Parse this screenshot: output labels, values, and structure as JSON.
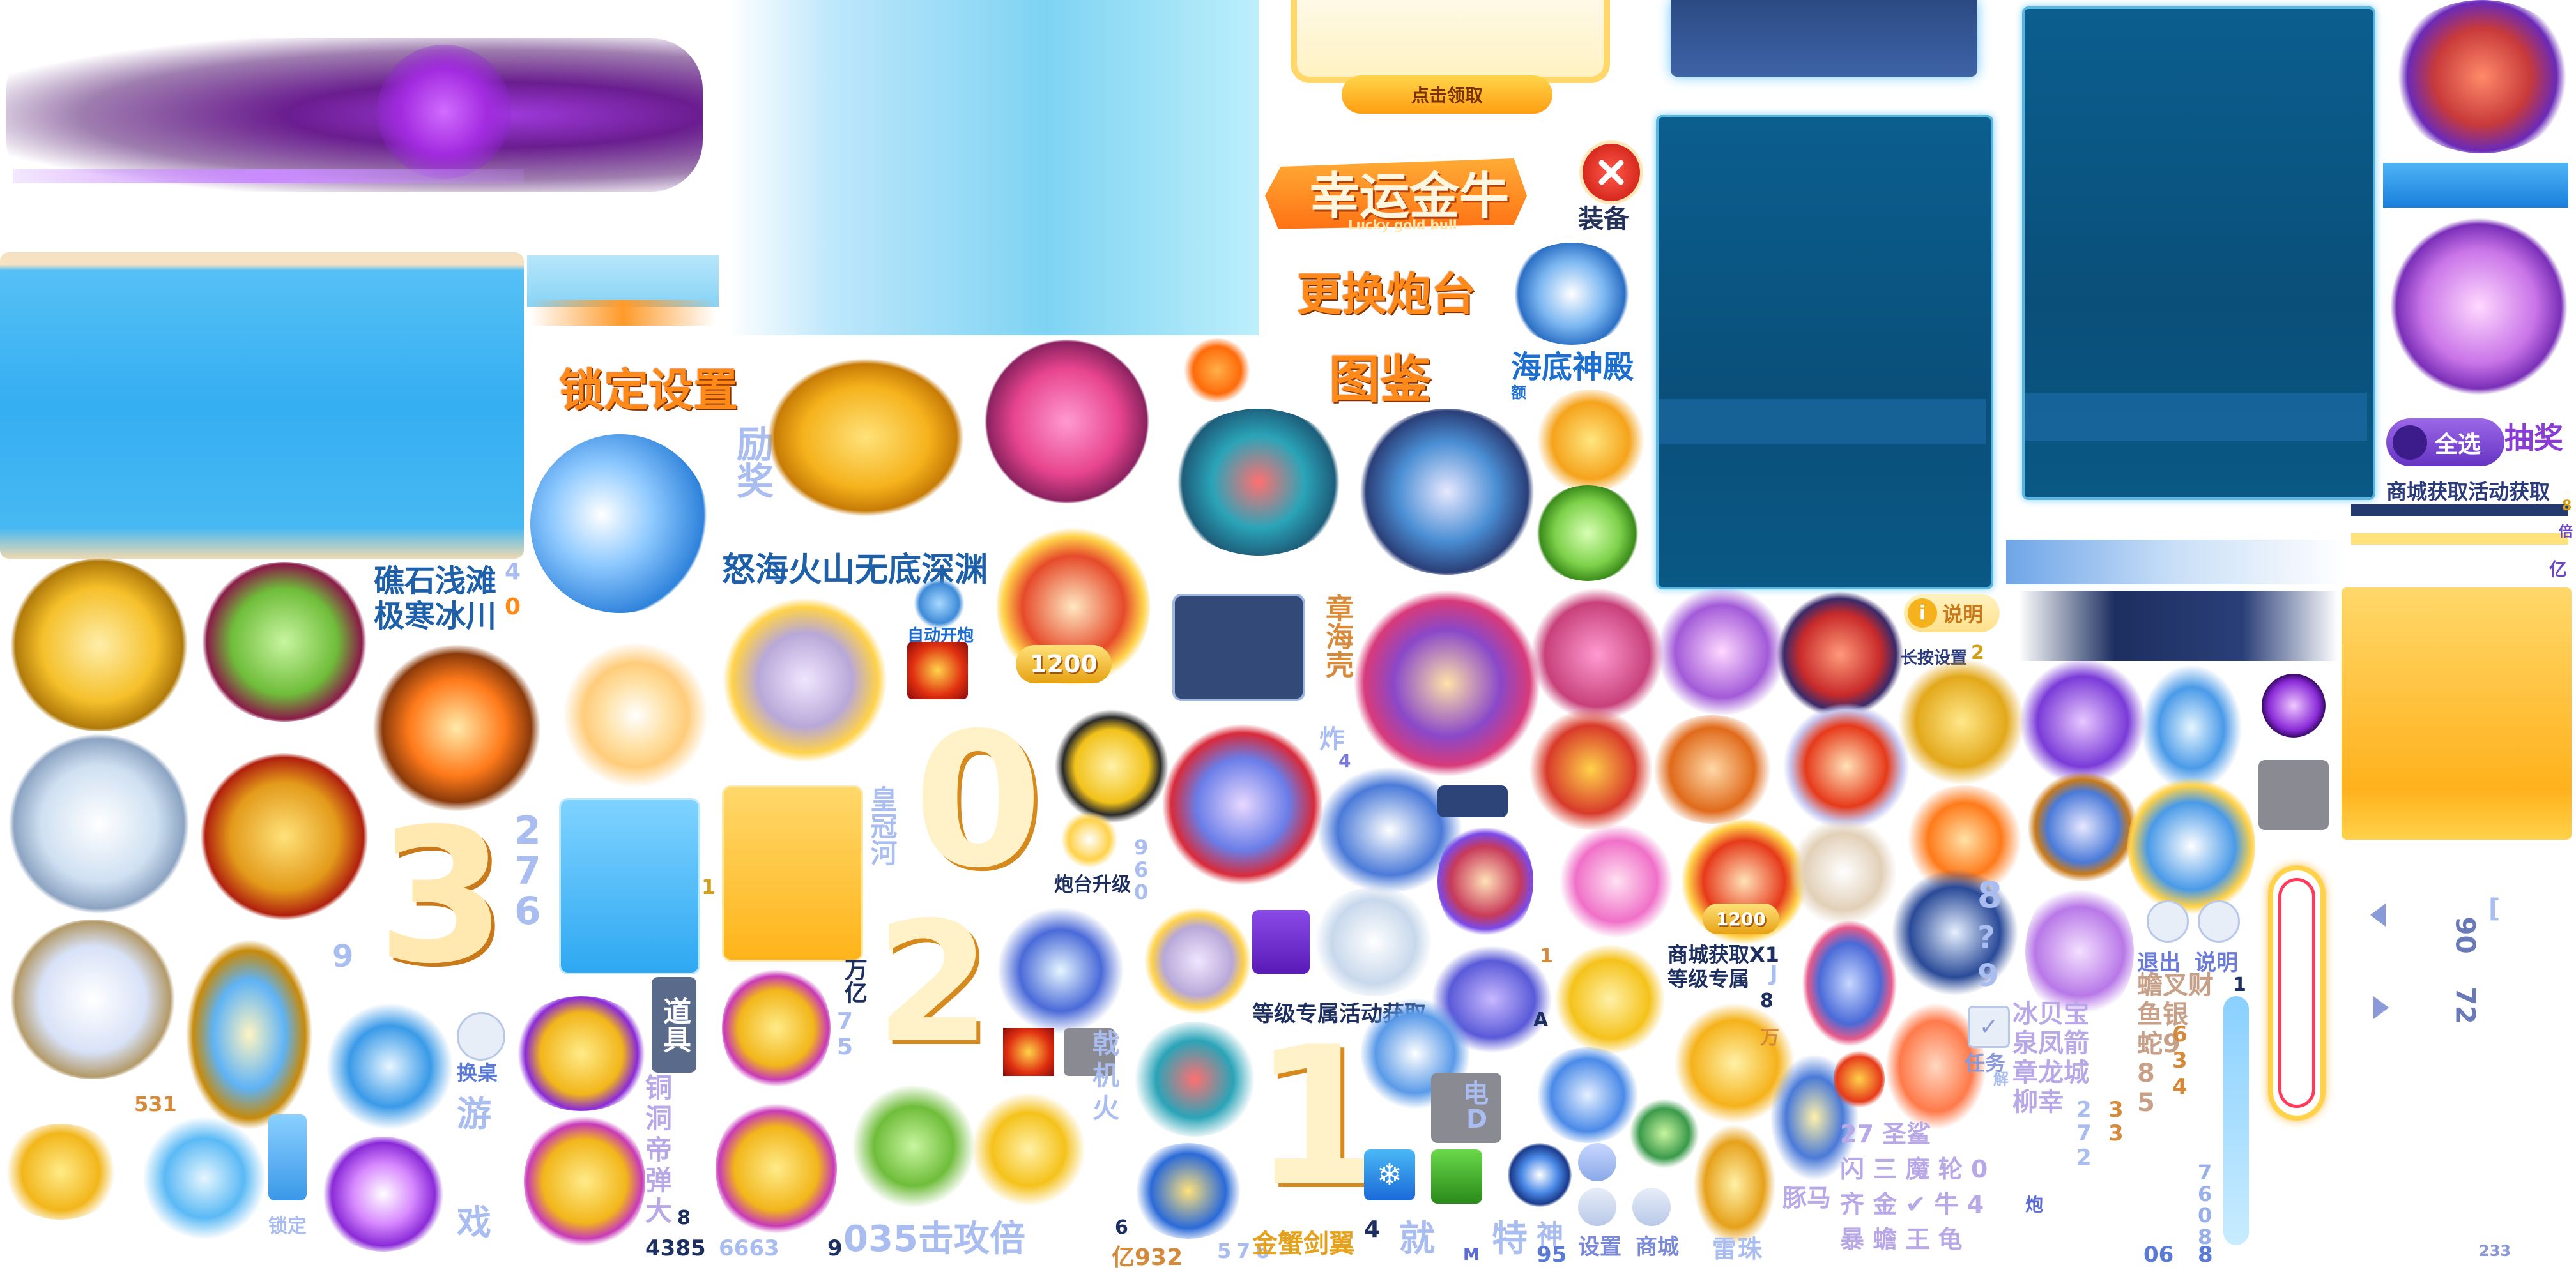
{
  "atlas": {
    "claim_button": "点击领取",
    "lucky_bull_title": "幸运金牛",
    "lucky_bull_subtitle": "Lucky gold bull",
    "equip_label": "装备",
    "change_turret": "更换炮台",
    "gallery": "图鉴",
    "lock_settings": "锁定设置",
    "poseidon_temple": "海底神殿",
    "temple_small": "额",
    "reward_vertical": "励奖",
    "map_reef": "礁石浅滩",
    "map_glacier": "极寒冰川",
    "map_digit_4": "4",
    "map_digit_0": "0",
    "map_names": "怒海火山无底深渊",
    "auto_fire": "自动开炮",
    "digit_1200": "1200",
    "digit_1200_b": "1200",
    "vertical_sea": "章海壳",
    "vertical_fire": "炸",
    "fire_small": "4",
    "info_label": "说明",
    "long_press": "长按设置",
    "long_press_num": "2",
    "select_all": "全选",
    "lottery": "抽奖",
    "shop_activity": "商城获取活动获取",
    "rate_8": "8",
    "rate_bei": "倍",
    "rate_yi": "亿",
    "big_3": "3",
    "big_0": "0",
    "big_2": "2",
    "big_1": "1",
    "nums_276": "2\n7\n6",
    "num_9": "9",
    "num_1": "1",
    "emperor_river": "皇冠河",
    "turret_upgrade": "炮台升级",
    "turret_nums": "9\n6\n0",
    "level_exclusive_activity": "等级专属活动获取",
    "shop_x1": "商城获取X1",
    "level_exclusive": "等级专属",
    "num_8": "8",
    "wan": "万",
    "j": "J",
    "a_label": "A",
    "n_label": "1",
    "qmark": "?",
    "num_8b": "8",
    "num_9b": "9",
    "change_table": "换桌",
    "you": "游",
    "xi": "戏",
    "props": "道具",
    "wan_yi": "万亿",
    "digits_75": "7\n5",
    "num_531": "531",
    "lock": "锁定",
    "bronze_silver": "铜\n洞\n帝\n弹\n大",
    "nums_bottom_1": "8",
    "nums_bottom_2": "4385",
    "nums_bottom_3": "6663",
    "nums_bottom_4": "9",
    "attack_row": "035击攻倍",
    "nums_6": "6",
    "yi932": "亿932",
    "num_5": "5",
    "num_7": "7",
    "num_6": "6",
    "gold_crab_row": "金蟹剑翼",
    "num_4": "4",
    "jiu": "就",
    "te": "特",
    "m": "M",
    "shen": "神",
    "num95": "95",
    "settings": "设置",
    "shop": "商城",
    "lei": "雷",
    "zhu": "珠",
    "dian": "电",
    "d": "D",
    "tasks": "任务",
    "jie": "解",
    "exit": "退出",
    "explain": "说明",
    "char_grid": "冰贝宝\n泉凤箭\n章龙城\n柳幸",
    "char_grid2": "蟾叉财\n鱼银\n蛇9\n8\n5",
    "num_col_a": "2\n7\n2",
    "num_col_b": "6\n3\n4",
    "num_col_c": "3\n3",
    "num_1b": "1",
    "right_col_nums": "7\n6\n0\n8",
    "num_06": "06",
    "num_8c": "8",
    "num_233": "233",
    "bracket_left": "[",
    "num_90": "90",
    "num_72": "72",
    "row_fish_1": "27 圣鲨",
    "row_fish_2": "闪 三 魔 轮 0",
    "row_fish_3": "齐 金 ✔ 牛 4",
    "row_fish_4": "暴 蟾 王 龟",
    "row_fish_5": "豚马",
    "paotai": "炮",
    "ji_ji_huo": "戟\n机\n火",
    "num_931": "1"
  },
  "colors": {
    "title_orange": "#ff8a1a",
    "deep_blue": "#0a5885",
    "sky_blue": "#47b8f3",
    "gold": "#ffc52e",
    "purple": "#8a3bd6"
  },
  "icons": [
    "close-icon",
    "fish-icon",
    "crab-icon",
    "shark-icon",
    "turtle-icon",
    "octopus-icon",
    "coin-icon",
    "trident-icon",
    "orb-icon",
    "check-icon",
    "settings-icon",
    "shop-icon"
  ]
}
